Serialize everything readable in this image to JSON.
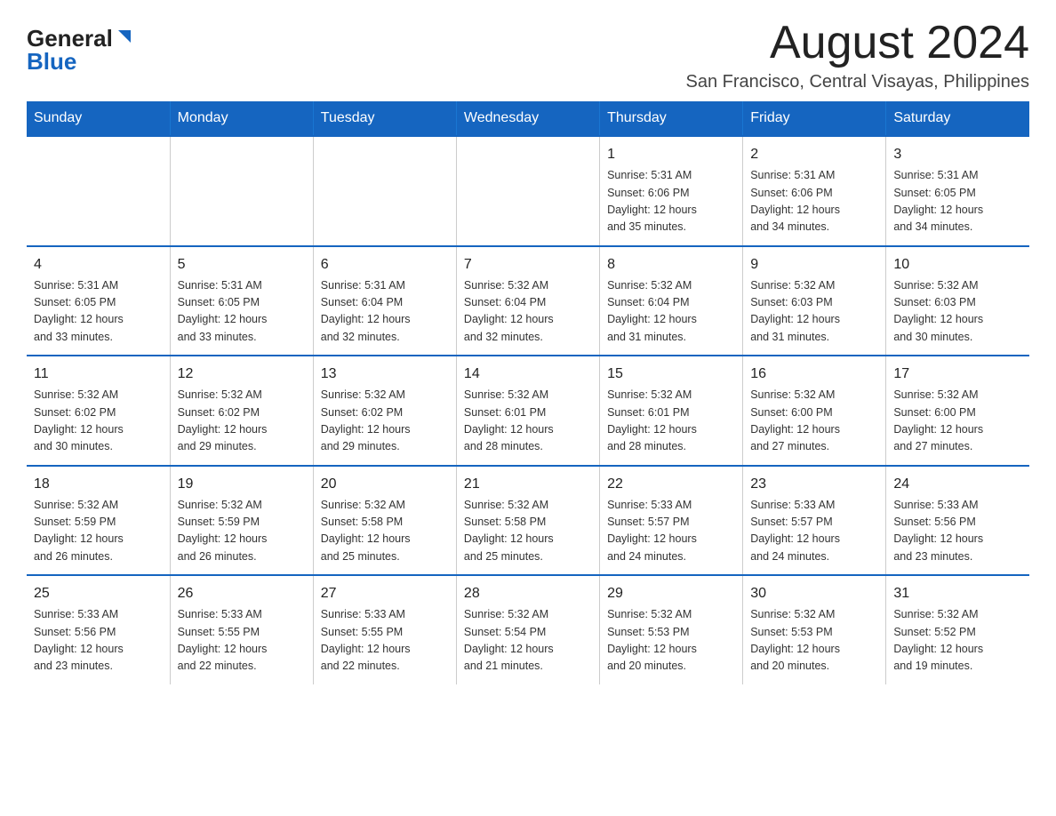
{
  "logo": {
    "general": "General",
    "blue": "Blue"
  },
  "header": {
    "month": "August 2024",
    "location": "San Francisco, Central Visayas, Philippines"
  },
  "weekdays": [
    "Sunday",
    "Monday",
    "Tuesday",
    "Wednesday",
    "Thursday",
    "Friday",
    "Saturday"
  ],
  "weeks": [
    [
      {
        "day": "",
        "info": ""
      },
      {
        "day": "",
        "info": ""
      },
      {
        "day": "",
        "info": ""
      },
      {
        "day": "",
        "info": ""
      },
      {
        "day": "1",
        "info": "Sunrise: 5:31 AM\nSunset: 6:06 PM\nDaylight: 12 hours\nand 35 minutes."
      },
      {
        "day": "2",
        "info": "Sunrise: 5:31 AM\nSunset: 6:06 PM\nDaylight: 12 hours\nand 34 minutes."
      },
      {
        "day": "3",
        "info": "Sunrise: 5:31 AM\nSunset: 6:05 PM\nDaylight: 12 hours\nand 34 minutes."
      }
    ],
    [
      {
        "day": "4",
        "info": "Sunrise: 5:31 AM\nSunset: 6:05 PM\nDaylight: 12 hours\nand 33 minutes."
      },
      {
        "day": "5",
        "info": "Sunrise: 5:31 AM\nSunset: 6:05 PM\nDaylight: 12 hours\nand 33 minutes."
      },
      {
        "day": "6",
        "info": "Sunrise: 5:31 AM\nSunset: 6:04 PM\nDaylight: 12 hours\nand 32 minutes."
      },
      {
        "day": "7",
        "info": "Sunrise: 5:32 AM\nSunset: 6:04 PM\nDaylight: 12 hours\nand 32 minutes."
      },
      {
        "day": "8",
        "info": "Sunrise: 5:32 AM\nSunset: 6:04 PM\nDaylight: 12 hours\nand 31 minutes."
      },
      {
        "day": "9",
        "info": "Sunrise: 5:32 AM\nSunset: 6:03 PM\nDaylight: 12 hours\nand 31 minutes."
      },
      {
        "day": "10",
        "info": "Sunrise: 5:32 AM\nSunset: 6:03 PM\nDaylight: 12 hours\nand 30 minutes."
      }
    ],
    [
      {
        "day": "11",
        "info": "Sunrise: 5:32 AM\nSunset: 6:02 PM\nDaylight: 12 hours\nand 30 minutes."
      },
      {
        "day": "12",
        "info": "Sunrise: 5:32 AM\nSunset: 6:02 PM\nDaylight: 12 hours\nand 29 minutes."
      },
      {
        "day": "13",
        "info": "Sunrise: 5:32 AM\nSunset: 6:02 PM\nDaylight: 12 hours\nand 29 minutes."
      },
      {
        "day": "14",
        "info": "Sunrise: 5:32 AM\nSunset: 6:01 PM\nDaylight: 12 hours\nand 28 minutes."
      },
      {
        "day": "15",
        "info": "Sunrise: 5:32 AM\nSunset: 6:01 PM\nDaylight: 12 hours\nand 28 minutes."
      },
      {
        "day": "16",
        "info": "Sunrise: 5:32 AM\nSunset: 6:00 PM\nDaylight: 12 hours\nand 27 minutes."
      },
      {
        "day": "17",
        "info": "Sunrise: 5:32 AM\nSunset: 6:00 PM\nDaylight: 12 hours\nand 27 minutes."
      }
    ],
    [
      {
        "day": "18",
        "info": "Sunrise: 5:32 AM\nSunset: 5:59 PM\nDaylight: 12 hours\nand 26 minutes."
      },
      {
        "day": "19",
        "info": "Sunrise: 5:32 AM\nSunset: 5:59 PM\nDaylight: 12 hours\nand 26 minutes."
      },
      {
        "day": "20",
        "info": "Sunrise: 5:32 AM\nSunset: 5:58 PM\nDaylight: 12 hours\nand 25 minutes."
      },
      {
        "day": "21",
        "info": "Sunrise: 5:32 AM\nSunset: 5:58 PM\nDaylight: 12 hours\nand 25 minutes."
      },
      {
        "day": "22",
        "info": "Sunrise: 5:33 AM\nSunset: 5:57 PM\nDaylight: 12 hours\nand 24 minutes."
      },
      {
        "day": "23",
        "info": "Sunrise: 5:33 AM\nSunset: 5:57 PM\nDaylight: 12 hours\nand 24 minutes."
      },
      {
        "day": "24",
        "info": "Sunrise: 5:33 AM\nSunset: 5:56 PM\nDaylight: 12 hours\nand 23 minutes."
      }
    ],
    [
      {
        "day": "25",
        "info": "Sunrise: 5:33 AM\nSunset: 5:56 PM\nDaylight: 12 hours\nand 23 minutes."
      },
      {
        "day": "26",
        "info": "Sunrise: 5:33 AM\nSunset: 5:55 PM\nDaylight: 12 hours\nand 22 minutes."
      },
      {
        "day": "27",
        "info": "Sunrise: 5:33 AM\nSunset: 5:55 PM\nDaylight: 12 hours\nand 22 minutes."
      },
      {
        "day": "28",
        "info": "Sunrise: 5:32 AM\nSunset: 5:54 PM\nDaylight: 12 hours\nand 21 minutes."
      },
      {
        "day": "29",
        "info": "Sunrise: 5:32 AM\nSunset: 5:53 PM\nDaylight: 12 hours\nand 20 minutes."
      },
      {
        "day": "30",
        "info": "Sunrise: 5:32 AM\nSunset: 5:53 PM\nDaylight: 12 hours\nand 20 minutes."
      },
      {
        "day": "31",
        "info": "Sunrise: 5:32 AM\nSunset: 5:52 PM\nDaylight: 12 hours\nand 19 minutes."
      }
    ]
  ]
}
